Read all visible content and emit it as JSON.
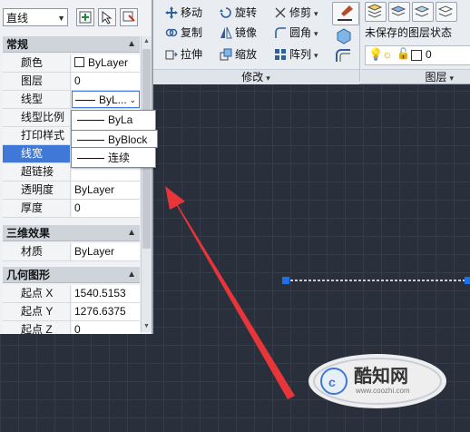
{
  "ribbon": {
    "modify": {
      "move": "移动",
      "rotate": "旋转",
      "trim": "修剪",
      "copy": "复制",
      "mirror": "镜像",
      "fillet": "圆角",
      "stretch": "拉伸",
      "scale": "缩放",
      "array": "阵列",
      "panel_label": "修改"
    },
    "layers": {
      "state_text": "未保存的图层状态",
      "current_layer": "0",
      "panel_label": "图层"
    }
  },
  "palette": {
    "object_type": "直线",
    "sections": {
      "general": "常规",
      "3d_effects": "三维效果",
      "geometry": "几何图形"
    },
    "general_rows": [
      {
        "key": "颜色",
        "value": "ByLayer"
      },
      {
        "key": "图层",
        "value": "0"
      },
      {
        "key": "线型",
        "value": "ByL..."
      },
      {
        "key": "线型比例",
        "value": ""
      },
      {
        "key": "打印样式",
        "value": ""
      },
      {
        "key": "线宽",
        "value": ""
      },
      {
        "key": "超链接",
        "value": ""
      },
      {
        "key": "透明度",
        "value": "ByLayer"
      },
      {
        "key": "厚度",
        "value": "0"
      }
    ],
    "material_row": {
      "key": "材质",
      "value": "ByLayer"
    },
    "geometry_rows": [
      {
        "key": "起点 X",
        "value": "1540.5153"
      },
      {
        "key": "起点 Y",
        "value": "1276.6375"
      },
      {
        "key": "起点 Z",
        "value": "0"
      }
    ]
  },
  "linetype_dropdown": {
    "options": [
      "ByLa",
      "ByBlock",
      "连续"
    ]
  },
  "watermark": {
    "brand": "酷知网",
    "url": "www.coozhi.com"
  }
}
